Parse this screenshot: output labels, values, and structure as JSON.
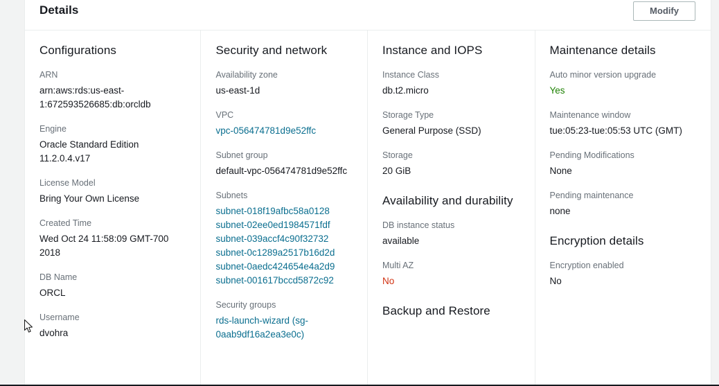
{
  "header": {
    "title": "Details",
    "modify_label": "Modify"
  },
  "columns": {
    "configurations": {
      "title": "Configurations",
      "fields": [
        {
          "label": "ARN",
          "value": "arn:aws:rds:us-east-1:672593526685:db:orcldb"
        },
        {
          "label": "Engine",
          "value": "Oracle Standard Edition 11.2.0.4.v17"
        },
        {
          "label": "License Model",
          "value": "Bring Your Own License"
        },
        {
          "label": "Created Time",
          "value": "Wed Oct 24 11:58:09 GMT-700 2018"
        },
        {
          "label": "DB Name",
          "value": "ORCL"
        },
        {
          "label": "Username",
          "value": "dvohra"
        }
      ]
    },
    "security_and_network": {
      "title": "Security and network",
      "availability_zone_label": "Availability zone",
      "availability_zone_value": "us-east-1d",
      "vpc_label": "VPC",
      "vpc_link": "vpc-056474781d9e52ffc",
      "subnet_group_label": "Subnet group",
      "subnet_group_value": "default-vpc-056474781d9e52ffc",
      "subnets_label": "Subnets",
      "subnets": [
        "subnet-018f19afbc58a0128",
        "subnet-02ee0ed1984571fdf",
        "subnet-039accf4c90f32732",
        "subnet-0c1289a2517b16d2d",
        "subnet-0aedc424654e4a2d9",
        "subnet-001617bccd5872c92"
      ],
      "security_groups_label": "Security groups",
      "security_groups": [
        "rds-launch-wizard (sg-0aab9df16a2ea3e0c)"
      ]
    },
    "instance_and_iops": {
      "title": "Instance and IOPS",
      "fields": [
        {
          "label": "Instance Class",
          "value": "db.t2.micro"
        },
        {
          "label": "Storage Type",
          "value": "General Purpose (SSD)"
        },
        {
          "label": "Storage",
          "value": "20 GiB"
        }
      ],
      "availability_title": "Availability and durability",
      "availability_fields": [
        {
          "label": "DB instance status",
          "value": "available",
          "status": "normal"
        },
        {
          "label": "Multi AZ",
          "value": "No",
          "status": "red"
        }
      ],
      "backup_title": "Backup and Restore"
    },
    "maintenance": {
      "title": "Maintenance details",
      "fields": [
        {
          "label": "Auto minor version upgrade",
          "value": "Yes",
          "status": "green"
        },
        {
          "label": "Maintenance window",
          "value": "tue:05:23-tue:05:53 UTC (GMT)",
          "status": "normal"
        },
        {
          "label": "Pending Modifications",
          "value": "None",
          "status": "normal"
        },
        {
          "label": "Pending maintenance",
          "value": "none",
          "status": "normal"
        }
      ],
      "encryption_title": "Encryption details",
      "encryption_fields": [
        {
          "label": "Encryption enabled",
          "value": "No",
          "status": "normal"
        }
      ]
    }
  },
  "colors": {
    "link": "#0a6e8f",
    "success": "#1d8102",
    "alert": "#d13212",
    "label": "#687078",
    "text": "#16191f"
  }
}
